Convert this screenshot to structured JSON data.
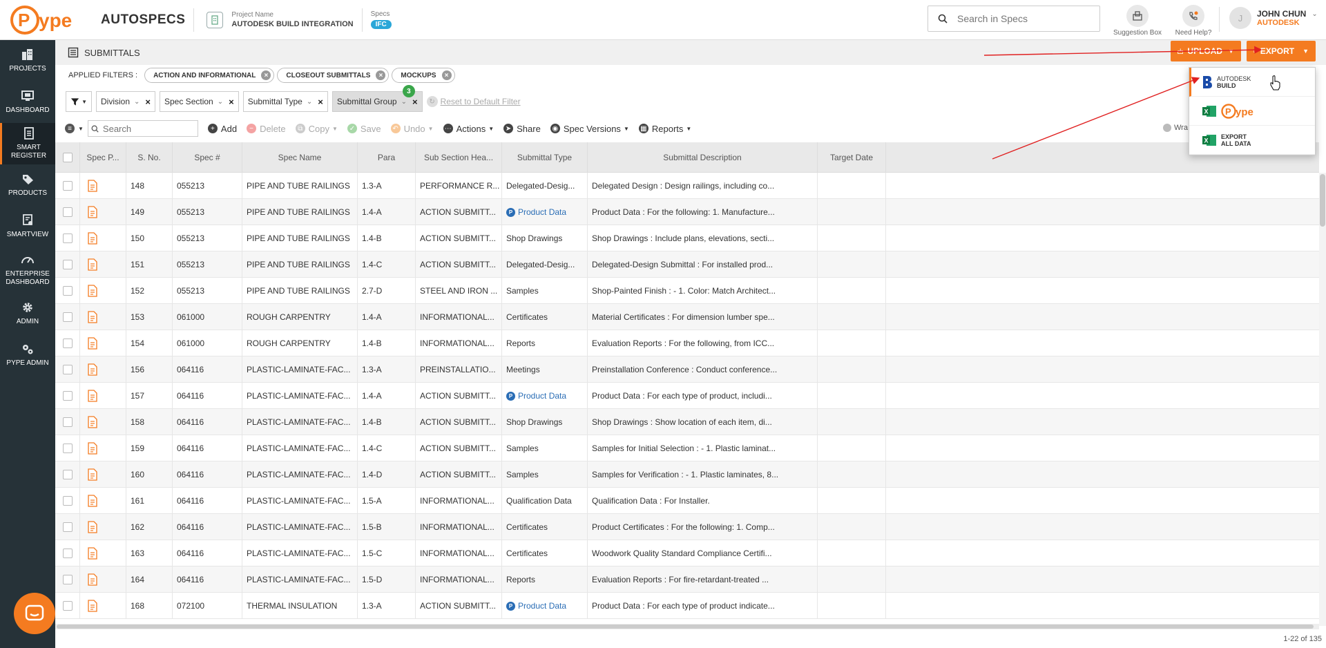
{
  "app": {
    "name": "AUTOSPECS",
    "logo_text": "Pype"
  },
  "project": {
    "label": "Project Name",
    "name": "AUTODESK BUILD INTEGRATION",
    "specs_label": "Specs",
    "specs_badge": "IFC"
  },
  "search": {
    "placeholder": "Search in Specs"
  },
  "top_icons": {
    "suggestion": "Suggestion Box",
    "help": "Need Help?"
  },
  "user": {
    "initial": "J",
    "name": "JOHN CHUN",
    "company": "AUTODESK"
  },
  "sidebar": {
    "items": [
      {
        "label": "PROJECTS"
      },
      {
        "label": "DASHBOARD"
      },
      {
        "label": "SMART REGISTER"
      },
      {
        "label": "PRODUCTS"
      },
      {
        "label": "SMARTVIEW"
      },
      {
        "label": "ENTERPRISE DASHBOARD"
      },
      {
        "label": "ADMIN"
      },
      {
        "label": "PYPE ADMIN"
      }
    ]
  },
  "header": {
    "title": "SUBMITTALS",
    "upload_label": "UPLOAD",
    "export_label": "EXPORT"
  },
  "export_menu": {
    "items": [
      {
        "line1": "AUTODESK",
        "line2": "BUILD"
      },
      {
        "line1": "Pype",
        "line2": ""
      },
      {
        "line1": "EXPORT",
        "line2": "ALL DATA"
      }
    ]
  },
  "filters": {
    "applied_label": "APPLIED FILTERS :",
    "chips": [
      "ACTION AND INFORMATIONAL",
      "CLOSEOUT SUBMITTALS",
      "MOCKUPS"
    ],
    "boxes": [
      "Division",
      "Spec Section",
      "Submittal Type",
      "Submittal Group"
    ],
    "group_badge": "3",
    "reset_label": "Reset to Default Filter"
  },
  "toolbar": {
    "search_placeholder": "Search",
    "add": "Add",
    "delete": "Delete",
    "copy": "Copy",
    "save": "Save",
    "undo": "Undo",
    "actions": "Actions",
    "share": "Share",
    "spec_versions": "Spec Versions",
    "reports": "Reports",
    "wrap": "Wra"
  },
  "table": {
    "columns": [
      "Spec P...",
      "S. No.",
      "Spec #",
      "Spec Name",
      "Para",
      "Sub Section Hea...",
      "Submittal Type",
      "Submittal Description",
      "Target Date"
    ],
    "rows": [
      [
        "148",
        "055213",
        "PIPE AND TUBE RAILINGS",
        "1.3-A",
        "PERFORMANCE R...",
        "Delegated-Desig...",
        "Delegated Design : Design railings, including co..."
      ],
      [
        "149",
        "055213",
        "PIPE AND TUBE RAILINGS",
        "1.4-A",
        "ACTION SUBMITT...",
        "Product Data",
        "Product Data : For the following: 1. Manufacture..."
      ],
      [
        "150",
        "055213",
        "PIPE AND TUBE RAILINGS",
        "1.4-B",
        "ACTION SUBMITT...",
        "Shop Drawings",
        "Shop Drawings : Include plans, elevations, secti..."
      ],
      [
        "151",
        "055213",
        "PIPE AND TUBE RAILINGS",
        "1.4-C",
        "ACTION SUBMITT...",
        "Delegated-Desig...",
        "Delegated-Design Submittal : For installed prod..."
      ],
      [
        "152",
        "055213",
        "PIPE AND TUBE RAILINGS",
        "2.7-D",
        "STEEL AND IRON ...",
        "Samples",
        "Shop-Painted Finish : - 1. Color: Match Architect..."
      ],
      [
        "153",
        "061000",
        "ROUGH CARPENTRY",
        "1.4-A",
        "INFORMATIONAL...",
        "Certificates",
        "Material Certificates : For dimension lumber spe..."
      ],
      [
        "154",
        "061000",
        "ROUGH CARPENTRY",
        "1.4-B",
        "INFORMATIONAL...",
        "Reports",
        "Evaluation Reports : For the following, from ICC..."
      ],
      [
        "156",
        "064116",
        "PLASTIC-LAMINATE-FAC...",
        "1.3-A",
        "PREINSTALLATIO...",
        "Meetings",
        "Preinstallation Conference : Conduct conference..."
      ],
      [
        "157",
        "064116",
        "PLASTIC-LAMINATE-FAC...",
        "1.4-A",
        "ACTION SUBMITT...",
        "Product Data",
        "Product Data : For each type of product, includi..."
      ],
      [
        "158",
        "064116",
        "PLASTIC-LAMINATE-FAC...",
        "1.4-B",
        "ACTION SUBMITT...",
        "Shop Drawings",
        "Shop Drawings : Show location of each item, di..."
      ],
      [
        "159",
        "064116",
        "PLASTIC-LAMINATE-FAC...",
        "1.4-C",
        "ACTION SUBMITT...",
        "Samples",
        "Samples for Initial Selection : - 1. Plastic laminat..."
      ],
      [
        "160",
        "064116",
        "PLASTIC-LAMINATE-FAC...",
        "1.4-D",
        "ACTION SUBMITT...",
        "Samples",
        "Samples for Verification : - 1. Plastic laminates, 8..."
      ],
      [
        "161",
        "064116",
        "PLASTIC-LAMINATE-FAC...",
        "1.5-A",
        "INFORMATIONAL...",
        "Qualification Data",
        "Qualification Data : For Installer."
      ],
      [
        "162",
        "064116",
        "PLASTIC-LAMINATE-FAC...",
        "1.5-B",
        "INFORMATIONAL...",
        "Certificates",
        "Product Certificates : For the following: 1. Comp..."
      ],
      [
        "163",
        "064116",
        "PLASTIC-LAMINATE-FAC...",
        "1.5-C",
        "INFORMATIONAL...",
        "Certificates",
        "Woodwork Quality Standard Compliance Certifi..."
      ],
      [
        "164",
        "064116",
        "PLASTIC-LAMINATE-FAC...",
        "1.5-D",
        "INFORMATIONAL...",
        "Reports",
        "Evaluation Reports : For fire-retardant-treated ..."
      ],
      [
        "168",
        "072100",
        "THERMAL INSULATION",
        "1.3-A",
        "ACTION SUBMITT...",
        "Product Data",
        "Product Data : For each type of product indicate..."
      ]
    ]
  },
  "footer": {
    "range": "1-22 of 135"
  },
  "colors": {
    "accent": "#f47b20",
    "sidebar": "#263238",
    "link": "#2a6db5",
    "annotation": "#e02020"
  }
}
